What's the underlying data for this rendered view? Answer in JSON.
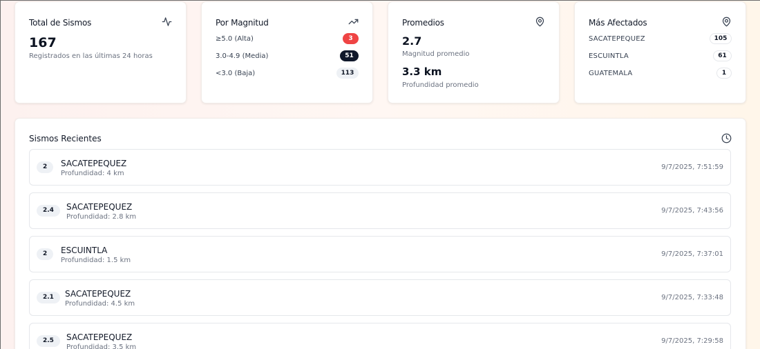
{
  "total": {
    "title": "Total de Sismos",
    "icon": "activity-icon",
    "value": "167",
    "caption": "Registrados en las últimas 24 horas"
  },
  "magnitude": {
    "title": "Por Magnitud",
    "icon": "trending-up-icon",
    "rows": [
      {
        "label": "≥5.0 (Alta)",
        "count": "3",
        "color": "#ef4444"
      },
      {
        "label": "3.0-4.9 (Media)",
        "count": "51",
        "color": "#0f172a"
      },
      {
        "label": "<3.0 (Baja)",
        "count": "113",
        "color": "#eef1f5"
      }
    ]
  },
  "averages": {
    "title": "Promedios",
    "icon": "map-pin-icon",
    "magnitude_value": "2.7",
    "magnitude_caption": "Magnitud promedio",
    "depth_value": "3.3 km",
    "depth_caption": "Profundidad promedio"
  },
  "affected": {
    "title": "Más Afectados",
    "icon": "map-pin-icon",
    "rows": [
      {
        "name": "SACATEPEQUEZ",
        "count": "105"
      },
      {
        "name": "ESCUINTLA",
        "count": "61"
      },
      {
        "name": "GUATEMALA",
        "count": "1"
      }
    ]
  },
  "recent": {
    "title": "Sismos Recientes",
    "icon": "clock-icon",
    "items": [
      {
        "magnitude": "2",
        "location": "SACATEPEQUEZ",
        "depth": "Profundidad: 4 km",
        "time": "9/7/2025, 7:51:59"
      },
      {
        "magnitude": "2.4",
        "location": "SACATEPEQUEZ",
        "depth": "Profundidad: 2.8 km",
        "time": "9/7/2025, 7:43:56"
      },
      {
        "magnitude": "2",
        "location": "ESCUINTLA",
        "depth": "Profundidad: 1.5 km",
        "time": "9/7/2025, 7:37:01"
      },
      {
        "magnitude": "2.1",
        "location": "SACATEPEQUEZ",
        "depth": "Profundidad: 4.5 km",
        "time": "9/7/2025, 7:33:48"
      },
      {
        "magnitude": "2.5",
        "location": "SACATEPEQUEZ",
        "depth": "Profundidad: 3.5 km",
        "time": "9/7/2025, 7:29:58"
      }
    ]
  }
}
